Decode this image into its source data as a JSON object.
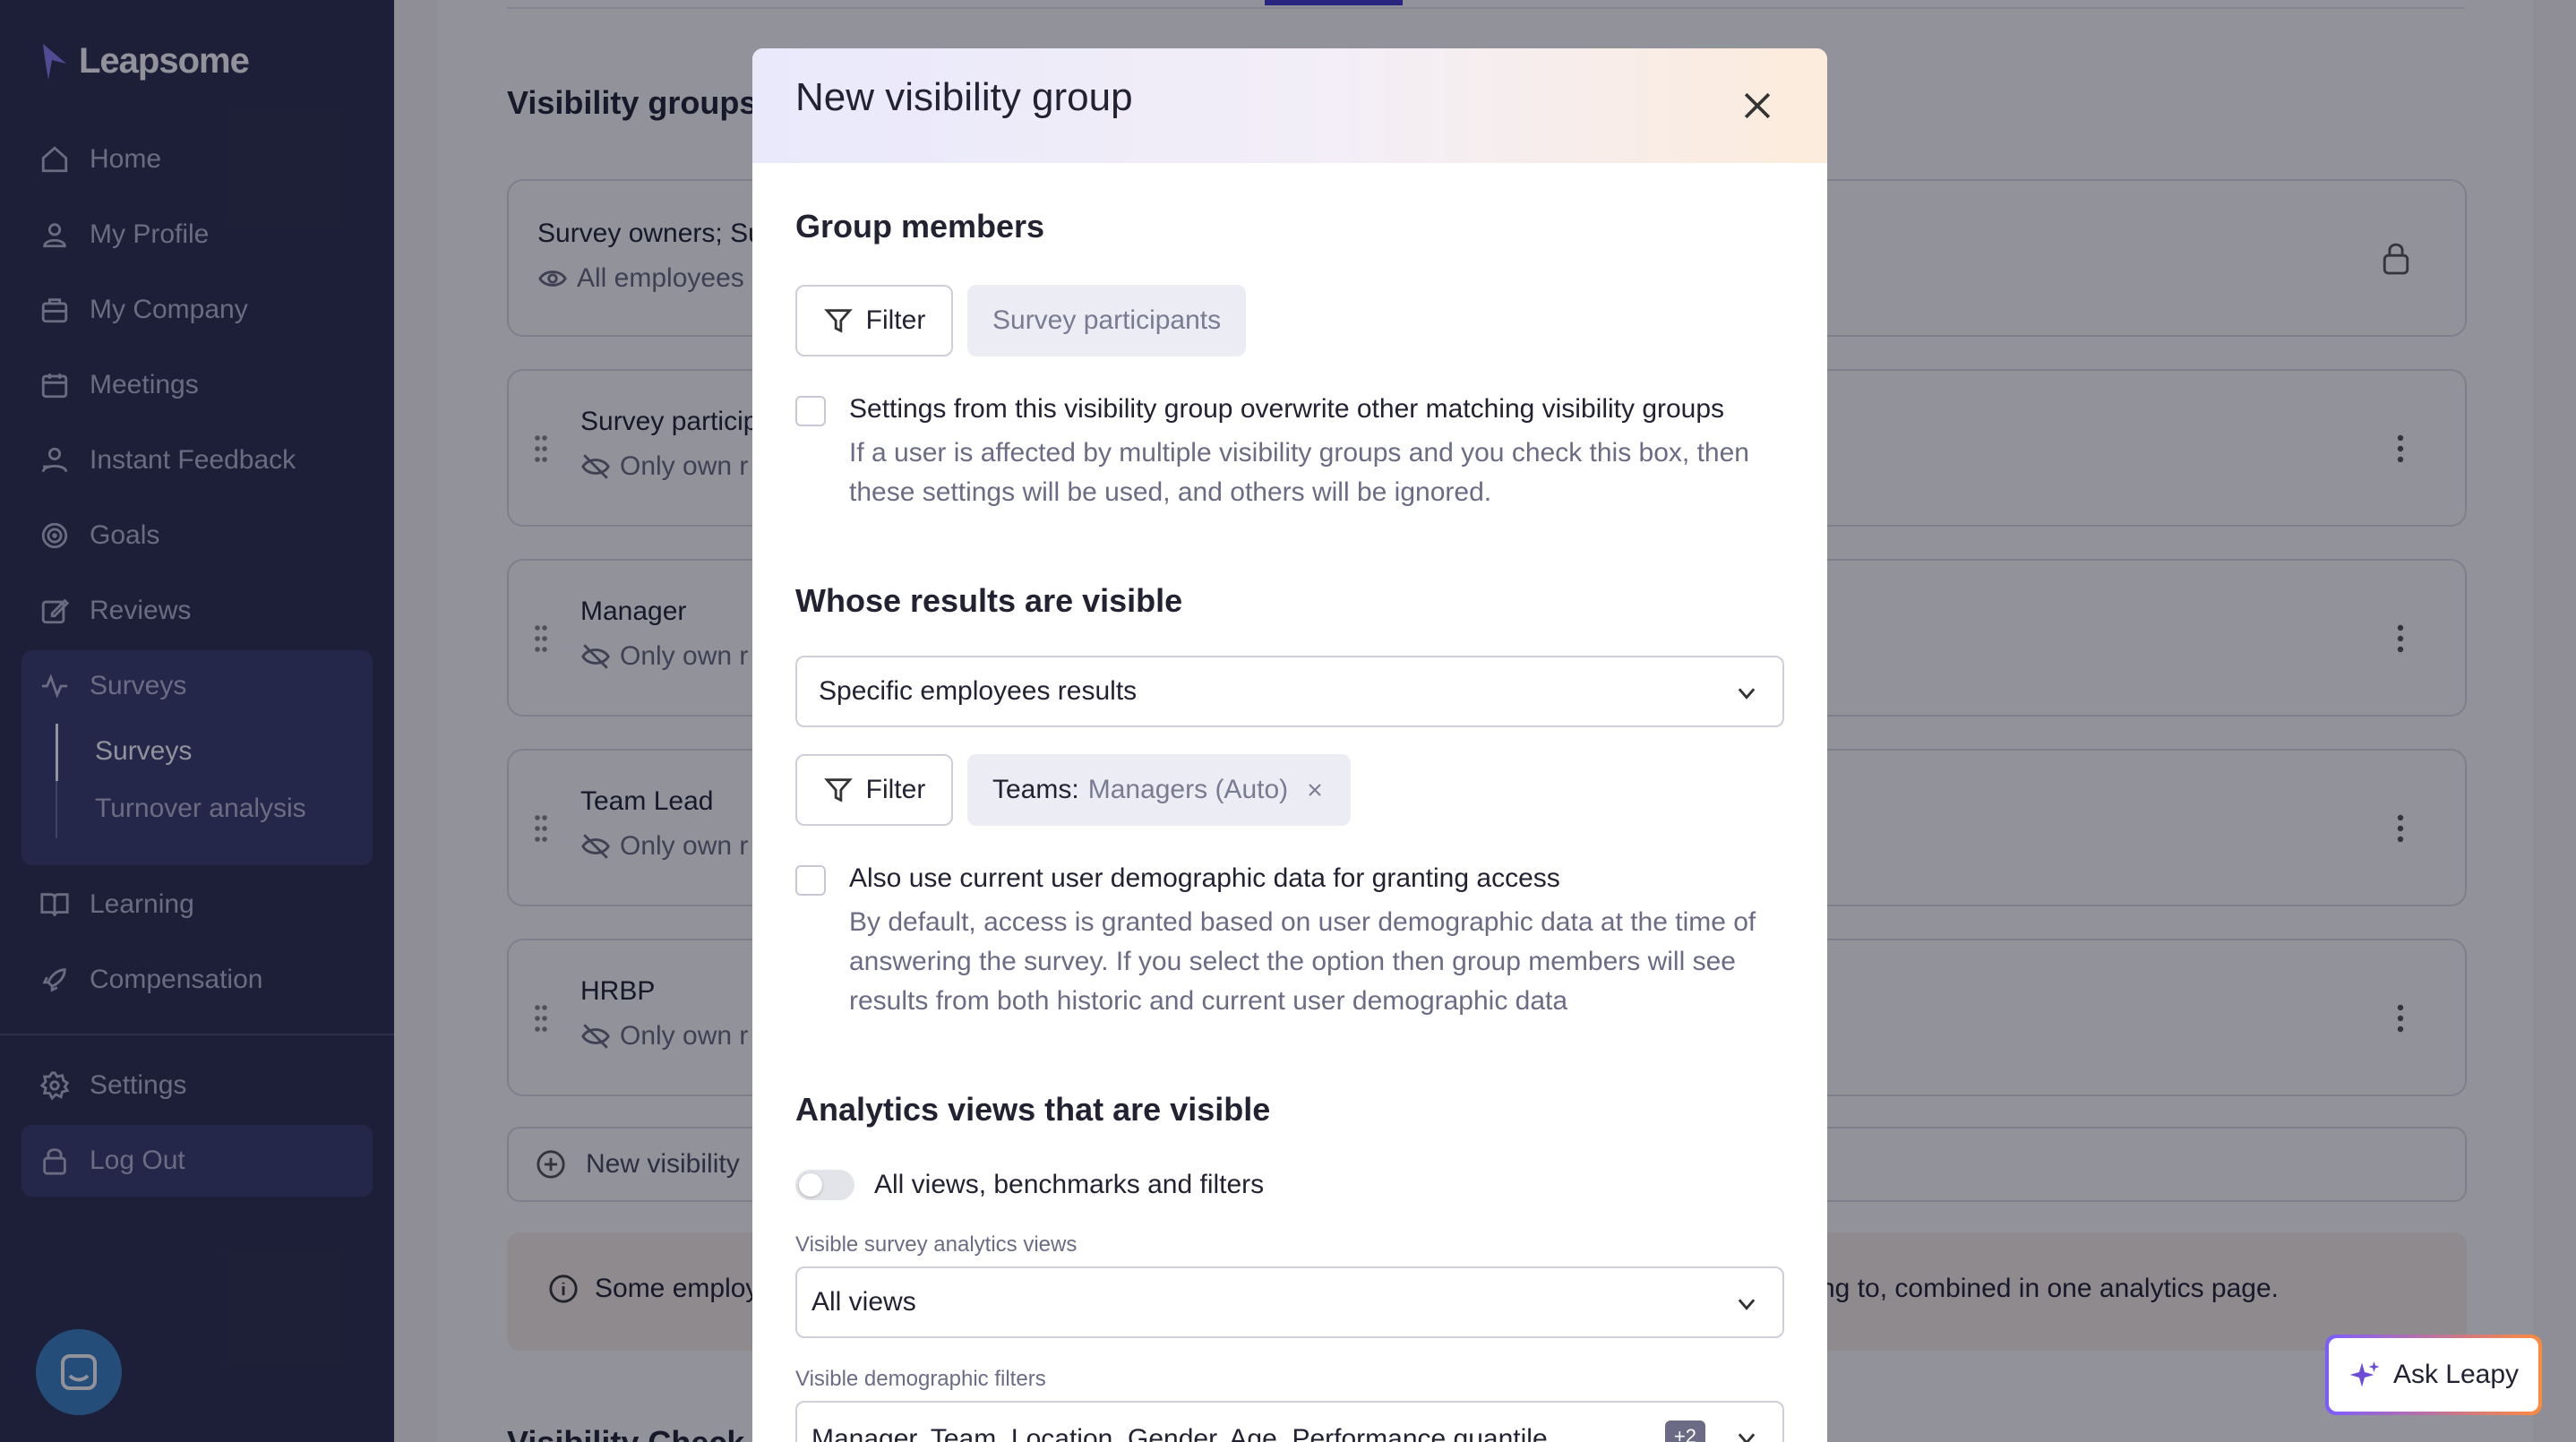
{
  "sidebar": {
    "logo": "Leapsome",
    "items": [
      {
        "label": "Home",
        "icon": "home-icon"
      },
      {
        "label": "My Profile",
        "icon": "user-icon"
      },
      {
        "label": "My Company",
        "icon": "company-icon"
      },
      {
        "label": "Meetings",
        "icon": "calendar-icon"
      },
      {
        "label": "Instant Feedback",
        "icon": "feedback-icon"
      },
      {
        "label": "Goals",
        "icon": "target-icon"
      },
      {
        "label": "Reviews",
        "icon": "edit-icon"
      },
      {
        "label": "Surveys",
        "icon": "pulse-icon"
      },
      {
        "label": "Learning",
        "icon": "book-icon"
      },
      {
        "label": "Compensation",
        "icon": "rocket-icon"
      },
      {
        "label": "Settings",
        "icon": "gear-icon"
      },
      {
        "label": "Log Out",
        "icon": "lock-icon"
      }
    ],
    "surveys_sub": [
      "Surveys",
      "Turnover analysis"
    ]
  },
  "main": {
    "title": "Visibility groups",
    "cards": [
      {
        "title": "Survey owners; Su",
        "sub": "All employees"
      },
      {
        "title": "Survey particip",
        "sub": "Only own r"
      },
      {
        "title": "Manager",
        "sub": "Only own r"
      },
      {
        "title": "Team Lead",
        "sub": "Only own r"
      },
      {
        "title": "HRBP",
        "sub": "Only own r"
      }
    ],
    "new_button": "New visibility",
    "info_left": "Some employ",
    "info_right": "ng to, combined in one analytics page.",
    "bottom_title": "Visibility Check"
  },
  "modal": {
    "title": "New visibility group",
    "group_members_title": "Group members",
    "filter_label": "Filter",
    "members_chip": "Survey participants",
    "overwrite_label": "Settings from this visibility group overwrite other matching visibility groups",
    "overwrite_help": "If a user is affected by multiple visibility groups and you check this box, then these settings will be used, and others will be ignored.",
    "whose_title": "Whose results are visible",
    "whose_select": "Specific employees results",
    "teams_chip_key": "Teams:",
    "teams_chip_value": "Managers (Auto)",
    "demographic_label": "Also use current user demographic data for granting access",
    "demographic_help": "By default, access is granted based on user demographic data at the time of answering the survey. If you select the option then group members will see results from both historic and current user demographic data",
    "analytics_title": "Analytics views that are visible",
    "toggle_label": "All views, benchmarks and filters",
    "views_label": "Visible survey analytics views",
    "views_value": "All views",
    "filters_label": "Visible demographic filters",
    "filters_value": "Manager, Team, Location, Gender, Age, Performance quantile",
    "filters_more": "+2"
  },
  "ask_leapy": "Ask Leapy",
  "colors": {
    "sidebar": "#2d2f4d",
    "active": "#393c6d",
    "accent": "#4338ca"
  }
}
